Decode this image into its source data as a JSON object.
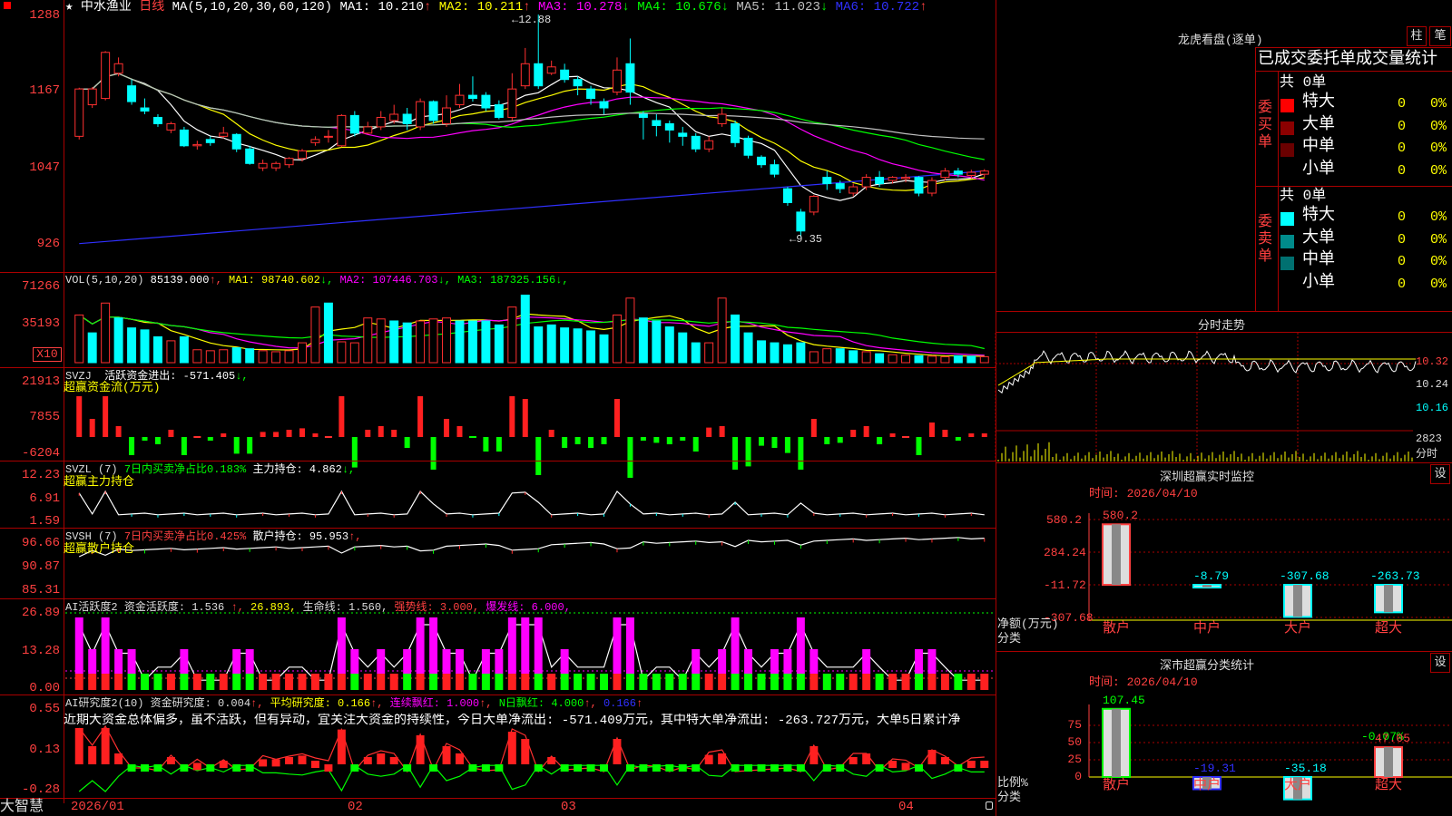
{
  "header": {
    "icon": "red-square-icon",
    "star": "★",
    "stock_name": "中水渔业",
    "period": "日线",
    "ma_label": "MA(5,10,20,30,60,120)",
    "ma_values": [
      {
        "label": "MA1: 10.210",
        "arrow": "↑",
        "color": "#ffffff"
      },
      {
        "label": "MA2: 10.211",
        "arrow": "↑",
        "color": "#ffff00"
      },
      {
        "label": "MA3: 10.278",
        "arrow": "↓",
        "color": "#ff00ff"
      },
      {
        "label": "MA4: 10.676",
        "arrow": "↓",
        "color": "#00ff00"
      },
      {
        "label": "MA5: 11.023",
        "arrow": "↓",
        "color": "#c0c0c0"
      },
      {
        "label": "MA6: 10.722",
        "arrow": "↑",
        "color": "#3030ff"
      }
    ]
  },
  "main_axis": [
    "12.88",
    "11.67",
    "10.47",
    "9.26"
  ],
  "main_axis_display": [
    "1288",
    "1167",
    "1047",
    "926"
  ],
  "annotations": {
    "high": "12.88",
    "low": "9.35"
  },
  "volume": {
    "label": "VOL(5,10,20)",
    "value": "85139.000",
    "items": [
      {
        "label": "MA1: 98740.602",
        "arrow": "↓",
        "color": "#ffff00"
      },
      {
        "label": "MA2: 107446.703",
        "arrow": "↓",
        "color": "#ff00ff"
      },
      {
        "label": "MA3: 187325.156",
        "arrow": "↓",
        "color": "#00ff00"
      }
    ],
    "axis": [
      "71266",
      "35193"
    ],
    "unit": "X10"
  },
  "svzj": {
    "label": "SVZJ",
    "title": "活跃资金进出: -571.405",
    "arrow": "↓,",
    "subtitle": "超赢资金流(万元)",
    "axis": [
      "21913",
      "7855",
      "-6204"
    ]
  },
  "svzl": {
    "label": "SVZL (7)",
    "text1": "7日内买卖净占比0.183%",
    "text2": "主力持仓: 4.862",
    "arrow": "↓,",
    "subtitle": "超赢主力持仓",
    "axis": [
      "12.23",
      "6.91",
      "1.59"
    ]
  },
  "svsh": {
    "label": "SVSH (7)",
    "text1": "7日内买卖净占比0.425%",
    "text2": "散户持仓: 95.953",
    "arrow": "↑,",
    "subtitle": "超赢散户持仓",
    "axis": [
      "96.66",
      "90.87",
      "85.31"
    ]
  },
  "ai1": {
    "label": "AI活跃度2",
    "items": [
      {
        "text": "资金活跃度: 1.536",
        "color": "#dddddd"
      },
      {
        "text": "↑,",
        "color": "#ff4040"
      },
      {
        "text": "26.893,",
        "color": "#ffff00"
      },
      {
        "text": "生命线: 1.560,",
        "color": "#dddddd"
      },
      {
        "text": "强势线: 3.000,",
        "color": "#ff4040"
      },
      {
        "text": "爆发线: 6.000,",
        "color": "#ff00ff"
      }
    ],
    "axis": [
      "26.89",
      "13.28",
      "0.00"
    ]
  },
  "ai2": {
    "label": "AI研究度2(10)",
    "items": [
      {
        "text": "资金研究度: 0.004",
        "color": "#dddddd"
      },
      {
        "text": "↑,",
        "color": "#ff4040"
      },
      {
        "text": "平均研究度: 0.166",
        "color": "#ffff00"
      },
      {
        "text": "↑,",
        "color": "#ff4040"
      },
      {
        "text": "连续飘红: 1.000",
        "color": "#ff00ff"
      },
      {
        "text": "↑,",
        "color": "#ff4040"
      },
      {
        "text": "N日飘红: 4.000",
        "color": "#00ff00"
      },
      {
        "text": "↑,",
        "color": "#ff4040"
      },
      {
        "text": "0.166",
        "color": "#3030ff"
      },
      {
        "text": "↑",
        "color": "#ff4040"
      }
    ],
    "commentary": "近期大资金总体偏多，虽不活跃，但有异动，宜关注大资金的持续性，今日大单净流出: -571.409万元，其中特大单净流出: -263.727万元，大单5日累计净",
    "axis": [
      "0.55",
      "0.13",
      "-0.28"
    ]
  },
  "footer": {
    "brand": "大智慧",
    "dates": [
      "2026/01",
      "02",
      "03",
      "04"
    ]
  },
  "right": {
    "lhb_title": "龙虎看盘(逐单)",
    "btn_bar": "柱",
    "btn_pen": "笔",
    "header_tabs": "已成交委托单成交量统计",
    "buy_label": "委买单",
    "sell_label": "委卖单",
    "buy_total": "共 0单",
    "sell_total": "共 0单",
    "buy_rows": [
      {
        "name": "特大",
        "count": "0",
        "pct": "0%",
        "color": "#ff0000"
      },
      {
        "name": "大单",
        "count": "0",
        "pct": "0%",
        "color": "#8b0000"
      },
      {
        "name": "中单",
        "count": "0",
        "pct": "0%",
        "color": "#6a0000"
      },
      {
        "name": "小单",
        "count": "0",
        "pct": "0%",
        "color": "#000000"
      }
    ],
    "sell_rows": [
      {
        "name": "特大",
        "count": "0",
        "pct": "0%",
        "color": "#00ffff"
      },
      {
        "name": "大单",
        "count": "0",
        "pct": "0%",
        "color": "#008b8b"
      },
      {
        "name": "中单",
        "count": "0",
        "pct": "0%",
        "color": "#007070"
      },
      {
        "name": "小单",
        "count": "0",
        "pct": "0%",
        "color": "#000000"
      }
    ],
    "intraday_title": "分时走势",
    "intraday_axis": [
      "10.32",
      "10.24",
      "10.16",
      "2823",
      "分时"
    ],
    "sz_title": "深圳超赢实时监控",
    "sz_btn": "设",
    "sz_time": "时间: 2026/04/10",
    "sz_axis": [
      "580.2",
      "284.24",
      "-11.72",
      "-307.68"
    ],
    "sz_unit": "净额(万元)",
    "sz_axis_title": "分类",
    "sz_values": [
      {
        "cat": "散户",
        "label": "580.2",
        "value": 580.2,
        "color": "#ff4040"
      },
      {
        "cat": "中户",
        "label": "-8.79",
        "value": -8.79,
        "color": "#00ffff"
      },
      {
        "cat": "大户",
        "label": "-307.68",
        "value": -307.68,
        "color": "#00ffff"
      },
      {
        "cat": "超大",
        "label": "-263.73",
        "value": -263.73,
        "color": "#00ffff"
      }
    ],
    "sh_title": "深市超赢分类统计",
    "sh_btn": "设",
    "sh_time": "时间: 2026/04/10",
    "sh_axis": [
      "75",
      "50",
      "25",
      "0"
    ],
    "sh_unit": "比例%",
    "sh_axis_title": "分类",
    "sh_top": "-0.07%",
    "sh_values": [
      {
        "cat": "散户",
        "label": "107.45",
        "value": 107.45,
        "color": "#00ff00"
      },
      {
        "cat": "中户",
        "label": "-19.31",
        "value": -19.31,
        "color": "#3030ff"
      },
      {
        "cat": "大户",
        "label": "-35.18",
        "value": -35.18,
        "color": "#00ffff"
      },
      {
        "cat": "超大",
        "label": "47.05",
        "value": 47.05,
        "color": "#ff4040"
      }
    ]
  },
  "chart_data": {
    "type": "candlestick",
    "candles": [
      [
        10.95,
        11.7,
        10.9,
        11.72
      ],
      [
        11.45,
        11.7,
        11.4,
        11.73
      ],
      [
        11.55,
        12.28,
        11.52,
        12.3
      ],
      [
        11.95,
        12.1,
        11.9,
        12.2
      ],
      [
        11.75,
        11.5,
        11.45,
        11.85
      ],
      [
        11.4,
        11.35,
        11.3,
        11.55
      ],
      [
        11.25,
        11.15,
        11.1,
        11.3
      ],
      [
        11.05,
        11.15,
        11.0,
        11.18
      ],
      [
        11.05,
        10.8,
        10.78,
        11.1
      ],
      [
        10.8,
        10.82,
        10.74,
        10.88
      ],
      [
        10.9,
        10.85,
        10.8,
        10.95
      ],
      [
        10.95,
        11.0,
        10.92,
        11.1
      ],
      [
        10.98,
        10.75,
        10.7,
        11.0
      ],
      [
        10.75,
        10.52,
        10.5,
        10.8
      ],
      [
        10.45,
        10.52,
        10.4,
        10.58
      ],
      [
        10.45,
        10.52,
        10.4,
        10.55
      ],
      [
        10.5,
        10.6,
        10.45,
        10.62
      ],
      [
        10.6,
        10.72,
        10.55,
        10.75
      ],
      [
        10.85,
        10.9,
        10.8,
        10.95
      ],
      [
        10.95,
        10.95,
        10.85,
        11.05
      ],
      [
        10.8,
        11.28,
        10.78,
        11.3
      ],
      [
        11.28,
        11.0,
        10.95,
        11.35
      ],
      [
        11.0,
        11.1,
        10.98,
        11.18
      ],
      [
        11.1,
        11.25,
        11.05,
        11.35
      ],
      [
        11.2,
        11.3,
        11.15,
        11.45
      ],
      [
        11.3,
        11.15,
        11.05,
        11.4
      ],
      [
        11.1,
        11.5,
        11.05,
        11.55
      ],
      [
        11.5,
        11.2,
        11.15,
        11.52
      ],
      [
        11.15,
        11.4,
        11.1,
        11.6
      ],
      [
        11.45,
        11.6,
        11.4,
        11.78
      ],
      [
        11.6,
        11.55,
        11.5,
        11.9
      ],
      [
        11.6,
        11.4,
        11.35,
        11.65
      ],
      [
        11.45,
        11.25,
        11.22,
        11.52
      ],
      [
        11.25,
        11.7,
        11.2,
        11.95
      ],
      [
        11.75,
        12.1,
        11.7,
        12.35
      ],
      [
        12.1,
        11.75,
        11.7,
        12.88
      ],
      [
        11.95,
        12.05,
        11.92,
        12.15
      ],
      [
        12.0,
        11.85,
        11.8,
        12.1
      ],
      [
        11.85,
        11.75,
        11.6,
        11.9
      ],
      [
        11.7,
        11.55,
        11.45,
        11.75
      ],
      [
        11.5,
        11.4,
        11.3,
        11.55
      ],
      [
        11.65,
        12.0,
        11.6,
        12.2
      ],
      [
        12.1,
        11.65,
        11.45,
        12.5
      ],
      [
        11.3,
        11.25,
        10.9,
        11.35
      ],
      [
        11.2,
        11.12,
        10.95,
        11.3
      ],
      [
        11.15,
        11.05,
        10.85,
        11.2
      ],
      [
        11.0,
        10.95,
        10.8,
        11.1
      ],
      [
        10.95,
        10.75,
        10.7,
        11.0
      ],
      [
        10.75,
        10.88,
        10.7,
        10.95
      ],
      [
        11.15,
        11.3,
        11.1,
        11.4
      ],
      [
        11.15,
        10.85,
        10.78,
        11.2
      ],
      [
        10.92,
        10.65,
        10.6,
        10.96
      ],
      [
        10.62,
        10.5,
        10.45,
        10.65
      ],
      [
        10.5,
        10.35,
        10.3,
        10.58
      ],
      [
        10.12,
        9.9,
        9.85,
        10.15
      ],
      [
        9.75,
        9.45,
        9.35,
        9.8
      ],
      [
        9.75,
        10.0,
        9.7,
        10.02
      ],
      [
        10.3,
        10.2,
        10.1,
        10.4
      ],
      [
        10.2,
        10.12,
        10.05,
        10.25
      ],
      [
        10.05,
        10.15,
        10.0,
        10.2
      ],
      [
        10.15,
        10.3,
        10.1,
        10.35
      ],
      [
        10.3,
        10.2,
        10.15,
        10.4
      ],
      [
        10.25,
        10.3,
        10.2,
        10.32
      ],
      [
        10.28,
        10.3,
        10.22,
        10.35
      ],
      [
        10.3,
        10.05,
        10.0,
        10.32
      ],
      [
        10.05,
        10.25,
        10.0,
        10.3
      ],
      [
        10.3,
        10.4,
        10.25,
        10.45
      ],
      [
        10.4,
        10.35,
        10.3,
        10.45
      ],
      [
        10.33,
        10.38,
        10.28,
        10.42
      ],
      [
        10.35,
        10.4,
        10.3,
        10.43
      ]
    ],
    "volume": [
      [
        48000,
        1
      ],
      [
        30000,
        0
      ],
      [
        60000,
        1
      ],
      [
        45000,
        0
      ],
      [
        35000,
        0
      ],
      [
        33000,
        0
      ],
      [
        26000,
        0
      ],
      [
        22000,
        1
      ],
      [
        26000,
        0
      ],
      [
        13000,
        1
      ],
      [
        12000,
        1
      ],
      [
        13000,
        1
      ],
      [
        15000,
        0
      ],
      [
        14000,
        0
      ],
      [
        12000,
        1
      ],
      [
        11000,
        1
      ],
      [
        12000,
        1
      ],
      [
        20000,
        1
      ],
      [
        56000,
        1
      ],
      [
        60000,
        0
      ],
      [
        21000,
        1
      ],
      [
        20000,
        1
      ],
      [
        45000,
        1
      ],
      [
        44000,
        1
      ],
      [
        42000,
        0
      ],
      [
        40000,
        0
      ],
      [
        42000,
        1
      ],
      [
        44000,
        1
      ],
      [
        45000,
        1
      ],
      [
        42000,
        0
      ],
      [
        42000,
        0
      ],
      [
        42000,
        0
      ],
      [
        38000,
        0
      ],
      [
        56000,
        1
      ],
      [
        68000,
        0
      ],
      [
        36000,
        0
      ],
      [
        38000,
        0
      ],
      [
        35000,
        0
      ],
      [
        34000,
        0
      ],
      [
        32000,
        0
      ],
      [
        28000,
        0
      ],
      [
        48000,
        1
      ],
      [
        65000,
        1
      ],
      [
        45000,
        0
      ],
      [
        42000,
        0
      ],
      [
        36000,
        0
      ],
      [
        30000,
        0
      ],
      [
        20000,
        0
      ],
      [
        20000,
        1
      ],
      [
        65000,
        1
      ],
      [
        48000,
        0
      ],
      [
        30000,
        0
      ],
      [
        22000,
        0
      ],
      [
        20000,
        0
      ],
      [
        18000,
        0
      ],
      [
        20000,
        0
      ],
      [
        11000,
        1
      ],
      [
        14000,
        1
      ],
      [
        14000,
        0
      ],
      [
        12000,
        0
      ],
      [
        11000,
        1
      ],
      [
        9000,
        0
      ],
      [
        8000,
        1
      ],
      [
        7500,
        1
      ],
      [
        7000,
        0
      ],
      [
        6500,
        1
      ],
      [
        6000,
        1
      ],
      [
        7000,
        0
      ],
      [
        6500,
        0
      ],
      [
        6000,
        1
      ]
    ]
  }
}
